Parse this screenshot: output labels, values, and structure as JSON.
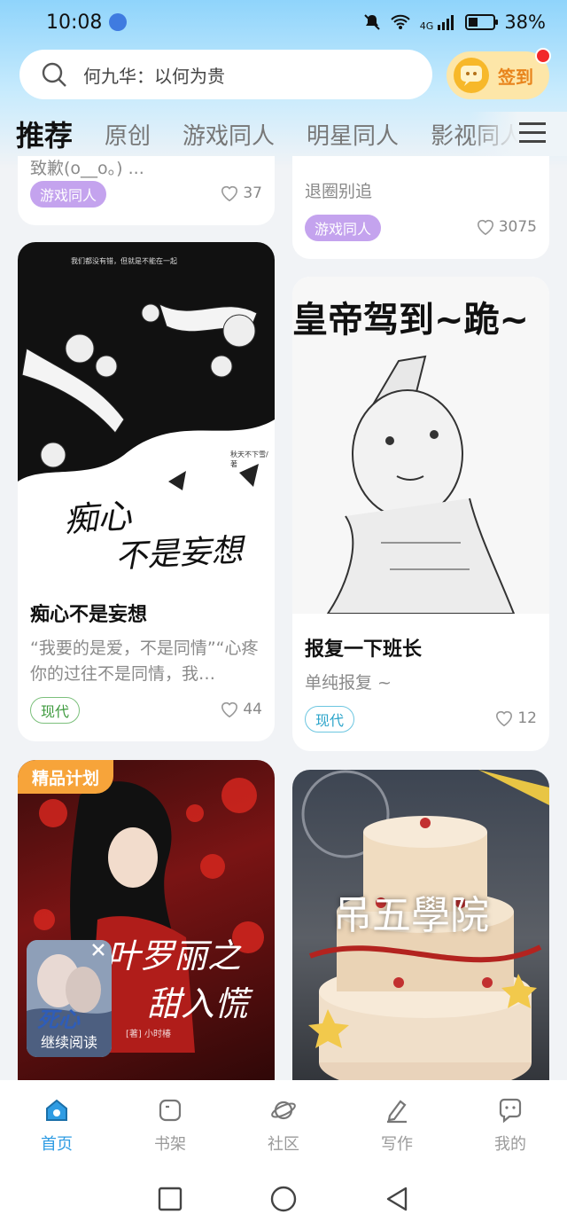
{
  "status": {
    "time": "10:08",
    "network": "4G",
    "battery": "38%",
    "battery_level": 0.38
  },
  "search": {
    "placeholder": "何九华：以何为贵"
  },
  "checkin": {
    "label": "签到",
    "has_notification": true
  },
  "tabs": [
    {
      "label": "推荐",
      "active": true
    },
    {
      "label": "原创",
      "active": false
    },
    {
      "label": "游戏同人",
      "active": false
    },
    {
      "label": "明星同人",
      "active": false
    },
    {
      "label": "影视同人",
      "active": false
    }
  ],
  "feed": {
    "left": [
      {
        "desc": "致歉(o__o。) ...",
        "tag": "游戏同人",
        "likes": "37"
      },
      {
        "cover_lines": [
          "痴心",
          "不是妄想"
        ],
        "cover_small_text": "我们都没有错，但就是不能在一起",
        "cover_author": "秋天不下雪/著",
        "title": "痴心不是妄想",
        "desc": "“我要的是爱，不是同情”“心疼你的过往不是同情，我…",
        "tag": "现代",
        "likes": "44"
      },
      {
        "badge": "精品计划",
        "cover_text": "叶罗丽之",
        "cover_text2": "甜入慌",
        "cover_author": "[著] 小时椿"
      }
    ],
    "right": [
      {
        "title_fragment": "皇",
        "desc": "退圈别追",
        "tag": "游戏同人",
        "likes": "3075"
      },
      {
        "cover_caption": "皇帝驾到~跪~",
        "title": "报复一下班长",
        "desc": "单纯报复 ~",
        "tag": "现代",
        "likes": "12"
      },
      {
        "cover_text": "吊五學院"
      }
    ]
  },
  "continue_reading": {
    "label": "继续阅读",
    "cover_text": "死心"
  },
  "bottom_nav": [
    {
      "label": "首页",
      "icon": "home-icon",
      "active": true
    },
    {
      "label": "书架",
      "icon": "bookshelf-icon",
      "active": false
    },
    {
      "label": "社区",
      "icon": "planet-icon",
      "active": false
    },
    {
      "label": "写作",
      "icon": "pen-icon",
      "active": false
    },
    {
      "label": "我的",
      "icon": "chat-face-icon",
      "active": false
    }
  ],
  "colors": {
    "accent": "#2f9ce3",
    "checkin_text": "#e8841c",
    "premium_badge": "#f7a43a",
    "tag_purple": "#c4a3ee"
  }
}
